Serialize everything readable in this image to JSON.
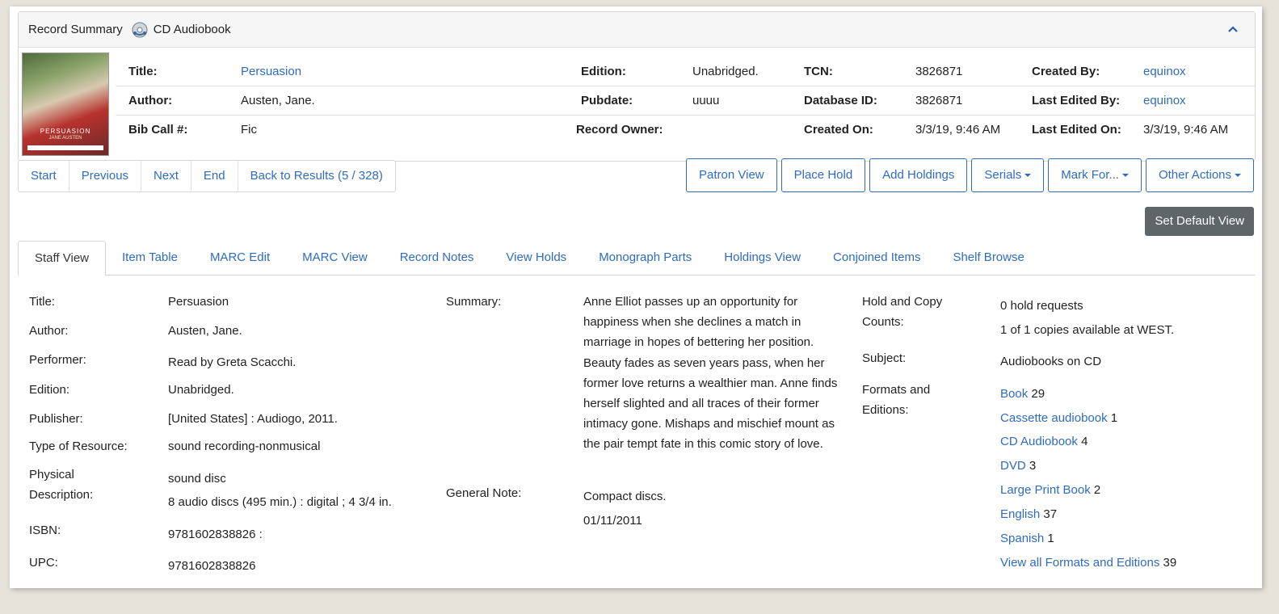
{
  "summary": {
    "header_title": "Record Summary",
    "format": "CD Audiobook",
    "cover": {
      "title": "PERSUASION",
      "author": "JANE AUSTEN"
    },
    "labels": {
      "title": "Title:",
      "author": "Author:",
      "bib_call": "Bib Call #:",
      "edition": "Edition:",
      "pubdate": "Pubdate:",
      "record_owner": "Record Owner:",
      "tcn": "TCN:",
      "database_id": "Database ID:",
      "created_on": "Created On:",
      "created_by": "Created By:",
      "last_edited_by": "Last Edited By:",
      "last_edited_on": "Last Edited On:"
    },
    "values": {
      "title": "Persuasion",
      "author": "Austen, Jane.",
      "bib_call": "Fic",
      "edition": "Unabridged.",
      "pubdate": "uuuu",
      "record_owner": "",
      "tcn": "3826871",
      "database_id": "3826871",
      "created_on": "3/3/19, 9:46 AM",
      "created_by": "equinox",
      "last_edited_by": "equinox",
      "last_edited_on": "3/3/19, 9:46 AM"
    }
  },
  "pager": {
    "start": "Start",
    "previous": "Previous",
    "next": "Next",
    "end": "End",
    "back": "Back to Results (5 / 328)"
  },
  "actions": {
    "patron_view": "Patron View",
    "place_hold": "Place Hold",
    "add_holdings": "Add Holdings",
    "serials": "Serials",
    "mark_for": "Mark For...",
    "other_actions": "Other Actions"
  },
  "set_default_view": "Set Default View",
  "tabs": [
    "Staff View",
    "Item Table",
    "MARC Edit",
    "MARC View",
    "Record Notes",
    "View Holds",
    "Monograph Parts",
    "Holdings View",
    "Conjoined Items",
    "Shelf Browse"
  ],
  "details": {
    "labels": {
      "title": "Title:",
      "author": "Author:",
      "performer": "Performer:",
      "edition": "Edition:",
      "publisher": "Publisher:",
      "type": "Type of Resource:",
      "physical_1": "Physical",
      "physical_2": "Description:",
      "isbn": "ISBN:",
      "upc": "UPC:",
      "summary": "Summary:",
      "general_note": "General Note:",
      "hold_1": "Hold and Copy",
      "hold_2": "Counts:",
      "subject": "Subject:",
      "formats_1": "Formats and",
      "formats_2": "Editions:"
    },
    "values": {
      "title": "Persuasion",
      "author": "Austen, Jane.",
      "performer": "Read by Greta Scacchi.",
      "edition": "Unabridged.",
      "publisher": "[United States] : Audiogo, 2011.",
      "type": "sound recording-nonmusical",
      "physical_1": "sound disc",
      "physical_2": "8 audio discs (495 min.) : digital ; 4 3/4 in.",
      "isbn": "9781602838826 :",
      "upc": "9781602838826",
      "summary": "Anne Elliot passes up an opportunity for happiness when she declines a match in marriage in hopes of bettering her position. Beauty fades as seven years pass, when her former love returns a wealthier man. Anne finds herself slighted and all traces of their former intimacy gone. Mishaps and mischief mount as the pair tempt fate in this comic story of love.",
      "general_note_1": "Compact discs.",
      "general_note_2": "01/11/2011",
      "hold_requests": "0 hold requests",
      "copies": "1 of 1 copies available at WEST.",
      "subject": "Audiobooks on CD"
    },
    "formats": [
      {
        "name": "Book",
        "count": "29"
      },
      {
        "name": "Cassette audiobook",
        "count": "1"
      },
      {
        "name": "CD Audiobook",
        "count": "4"
      },
      {
        "name": "DVD",
        "count": "3"
      },
      {
        "name": "Large Print Book",
        "count": "2"
      },
      {
        "name": "English",
        "count": "37"
      },
      {
        "name": "Spanish",
        "count": "1"
      },
      {
        "name": "View all Formats and Editions",
        "count": "39"
      }
    ]
  }
}
